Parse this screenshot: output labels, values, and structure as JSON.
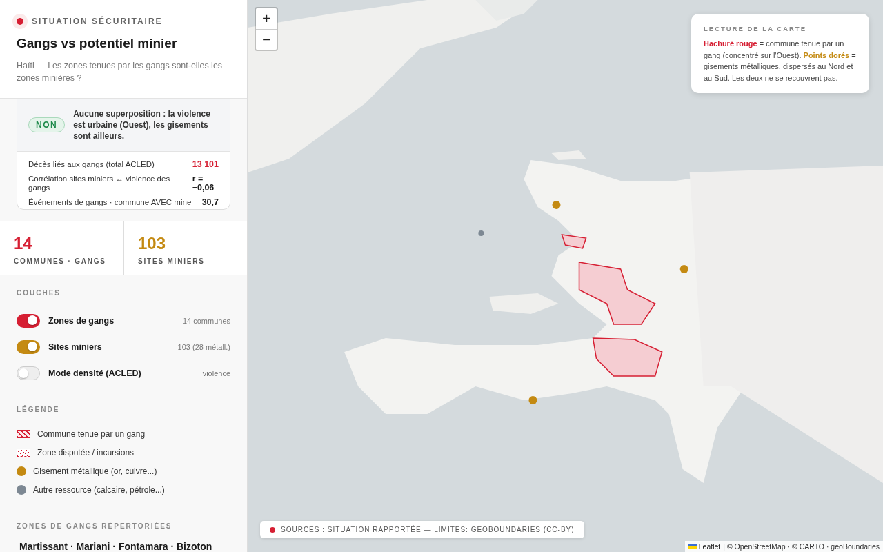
{
  "header": {
    "kicker": "SITUATION SÉCURITAIRE",
    "title": "Gangs vs potentiel minier",
    "subtitle": "Haïti — Les zones tenues par les gangs sont-elles les zones minières ?"
  },
  "verdict": {
    "badge": "NON",
    "text": "Aucune superposition : la violence est urbaine (Ouest), les gisements sont ailleurs.",
    "rows": [
      {
        "label": "Décès liés aux gangs (total ACLED)",
        "value": "13 101",
        "color": "#d61f33"
      },
      {
        "label": "Corrélation sites miniers ↔ violence des gangs",
        "value": "r = −0,06",
        "color": "#1a1a1a"
      },
      {
        "label": "Événements de gangs · commune AVEC mine",
        "value": "30,7",
        "color": "#1a1a1a"
      }
    ]
  },
  "stats": [
    {
      "value": "14",
      "label": "COMMUNES · GANGS",
      "color": "#d61f33"
    },
    {
      "value": "103",
      "label": "SITES MINIERS",
      "color": "#c48a12"
    }
  ],
  "layers": {
    "title": "COUCHES",
    "items": [
      {
        "label": "Zones de gangs",
        "note": "14 communes",
        "on": true,
        "color": "#d61f33"
      },
      {
        "label": "Sites miniers",
        "note": "103 (28 métall.)",
        "on": true,
        "color": "#c48a12"
      },
      {
        "label": "Mode densité (ACLED)",
        "note": "violence",
        "on": false
      }
    ]
  },
  "legend": {
    "title": "LÉGENDE",
    "items": [
      {
        "kind": "hatch",
        "label": "Commune tenue par un gang",
        "color": "#d61f33"
      },
      {
        "kind": "hatch-dashed",
        "label": "Zone disputée / incursions",
        "color": "#d61f33"
      },
      {
        "kind": "dot",
        "label": "Gisement métallique (or, cuivre...)",
        "color": "#c48a12"
      },
      {
        "kind": "dot",
        "label": "Autre ressource (calcaire, pétrole...)",
        "color": "#7d8893"
      }
    ]
  },
  "zones": {
    "title": "ZONES DE GANGS RÉPERTORIÉES",
    "list": "Martissant · Mariani · Fontamara · Bizoton"
  },
  "map": {
    "zoom_in": "+",
    "zoom_out": "−",
    "reading": {
      "title": "LECTURE DE LA CARTE",
      "text": "**Hachuré rouge** = commune tenue par un gang (concentré sur l'Ouest). **Points dorés** = gisements métalliques, dispersés au Nord et au Sud. Les deux ne se recouvrent pas."
    },
    "sources": "SOURCES : SITUATION RAPPORTÉE — LIMITES: GEOBOUNDARIES (CC-BY)",
    "attribution": {
      "link": "Leaflet",
      "text": "| © OpenStreetMap · © CARTO · geoBoundaries"
    }
  }
}
